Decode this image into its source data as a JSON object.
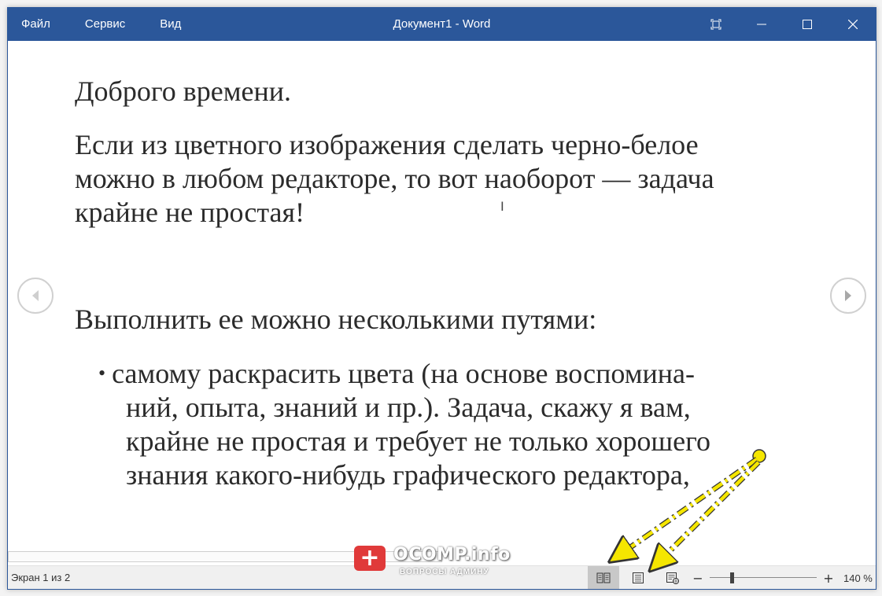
{
  "titlebar": {
    "menu": [
      "Файл",
      "Сервис",
      "Вид"
    ],
    "title": "Документ1  -  Word"
  },
  "document": {
    "p1": "Доброго времени.",
    "p2_lines": [
      "Если из цветного изображения сделать черно-белое",
      "можно в любом редакторе, то вот наоборот — задача",
      "крайне не простая!"
    ],
    "p3": "Выполнить ее можно несколькими путями:",
    "bullet_lines": [
      "самому раскрасить цвета (на основе воспомина-",
      "ний, опыта, знаний и пр.). Задача, скажу я вам,",
      "крайне не простая и требует не только хорошего",
      "знания какого-нибудь графического редактора,"
    ]
  },
  "status": {
    "page": "Экран 1 из 2",
    "zoom_level": "140 %",
    "zoom_minus": "−",
    "zoom_plus": "+",
    "zoom_fraction": 0.2
  },
  "watermark": {
    "badge": "+",
    "main": "OCOMP.info",
    "sub": "ВОПРОСЫ АДМИНУ"
  },
  "colors": {
    "accent": "#2b579a",
    "annotation": "#f5e600",
    "watermark_badge": "#e03a3a"
  }
}
